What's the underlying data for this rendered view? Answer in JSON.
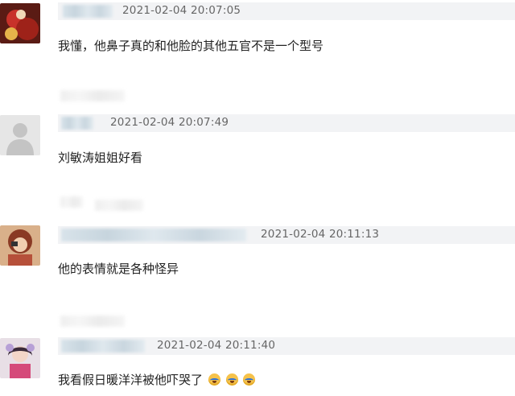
{
  "comments": [
    {
      "timestamp": "2021-02-04 20:07:05",
      "text": "我懂，他鼻子真的和他脸的其他五官不是一个型号",
      "avatar": "user-photo-red"
    },
    {
      "timestamp": "2021-02-04 20:07:49",
      "text": "刘敏涛姐姐好看",
      "avatar": "default-person-silhouette"
    },
    {
      "timestamp": "2021-02-04 20:11:13",
      "text": "他的表情就是各种怪异",
      "avatar": "user-photo-woman"
    },
    {
      "timestamp": "2021-02-04 20:11:40",
      "text": "我看假日暖洋洋被他吓哭了",
      "avatar": "user-photo-costume",
      "emojis": [
        "crying-face-icon",
        "crying-face-icon",
        "crying-face-icon"
      ]
    }
  ],
  "colors": {
    "header_bg": "#f2f3f5",
    "timestamp": "#666666",
    "text": "#222222"
  }
}
